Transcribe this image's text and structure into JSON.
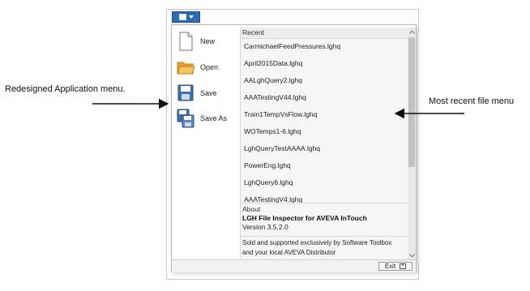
{
  "annotations": {
    "left": "Redesigned Application menu.",
    "right": "Most recent file menu"
  },
  "menu": {
    "commands": [
      {
        "label": "New",
        "icon": "new-file-icon"
      },
      {
        "label": "Open",
        "icon": "open-folder-icon"
      },
      {
        "label": "Save",
        "icon": "save-disk-icon"
      },
      {
        "label": "Save As",
        "icon": "save-as-icon"
      }
    ],
    "recent": {
      "header": "Recent",
      "items": [
        "CarmichaelFeedPressures.lghq",
        "April2015Data.lghq",
        "AALghQuery2.lghq",
        "AAATestingV44.lghq",
        "Train1TempVsFlow.lghq",
        "WOTemps1-6.lghq",
        "LghQueryTestAAAA.lghq",
        "PowerEng.lghq",
        "LghQuery6.lghq",
        "AAATestingV4.lghq"
      ]
    },
    "about": {
      "title": "About",
      "product": "LGH File Inspector for AVEVA InTouch",
      "version": "Version 3.5.2.0",
      "sold_line1": "Sold and supported exclusively by Software Toolbox",
      "sold_line2": "and your local AVEVA Distributor"
    },
    "exit_label": "Exit"
  },
  "colors": {
    "app_button": "#2b6cb8",
    "folder": "#f0b43c",
    "disk": "#3d6fb5"
  }
}
